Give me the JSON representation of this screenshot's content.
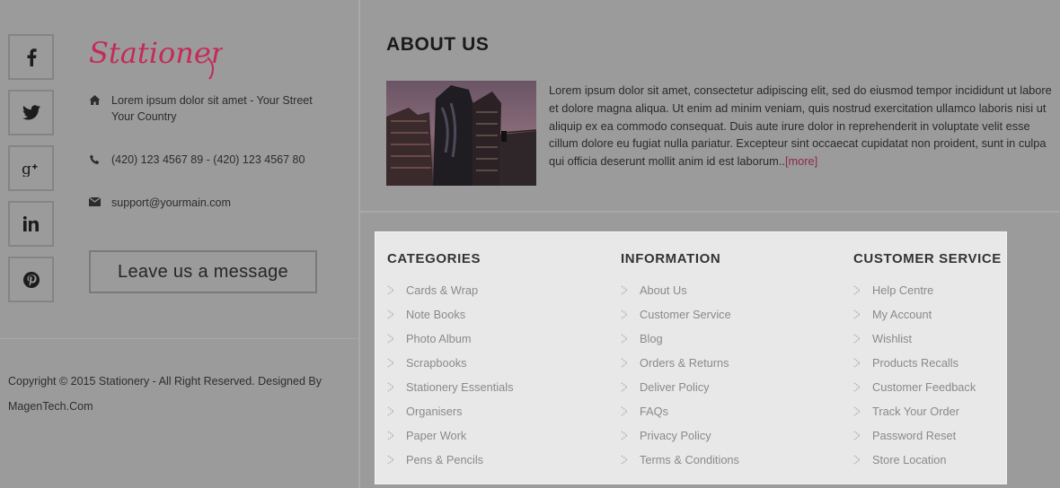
{
  "social": [
    "facebook-icon",
    "twitter-icon",
    "google-plus-icon",
    "linkedin-icon",
    "pinterest-icon"
  ],
  "brand": {
    "logo_text": "Stationery",
    "logo_color": "#c42a5a"
  },
  "contact": {
    "address": "Lorem ipsum dolor sit amet - Your Street Your Country",
    "phone": "(420) 123 4567 89 - (420) 123 4567 80",
    "email": "support@yourmain.com"
  },
  "leave_message_label": "Leave us a message",
  "copyright": "Copyright © 2015 Stationery - All Right Reserved. Designed By MagenTech.Com",
  "about": {
    "title": "ABOUT US",
    "text": "Lorem ipsum dolor sit amet, consectetur adipiscing elit, sed do eiusmod tempor incididunt ut labore et dolore magna aliqua. Ut enim ad minim veniam, quis nostrud exercitation ullamco laboris nisi ut aliquip ex ea commodo consequat. Duis aute irure dolor in reprehenderit in voluptate velit esse cillum dolore eu fugiat nulla pariatur. Excepteur sint occaecat cupidatat non proident, sunt in culpa qui officia deserunt mollit anim id est laborum..",
    "more_label": "[more]"
  },
  "columns": [
    {
      "title": "CATEGORIES",
      "items": [
        "Cards & Wrap",
        "Note Books",
        "Photo Album",
        "Scrapbooks",
        "Stationery Essentials",
        "Organisers",
        "Paper Work",
        "Pens & Pencils"
      ]
    },
    {
      "title": "INFORMATION",
      "items": [
        "About Us",
        "Customer Service",
        "Blog",
        "Orders & Returns",
        "Deliver Policy",
        "FAQs",
        "Privacy Policy",
        "Terms & Conditions"
      ]
    },
    {
      "title": "CUSTOMER SERVICE",
      "items": [
        "Help Centre",
        "My Account",
        "Wishlist",
        "Products Recalls",
        "Customer Feedback",
        "Track Your Order",
        "Password Reset",
        "Store Location"
      ]
    }
  ]
}
